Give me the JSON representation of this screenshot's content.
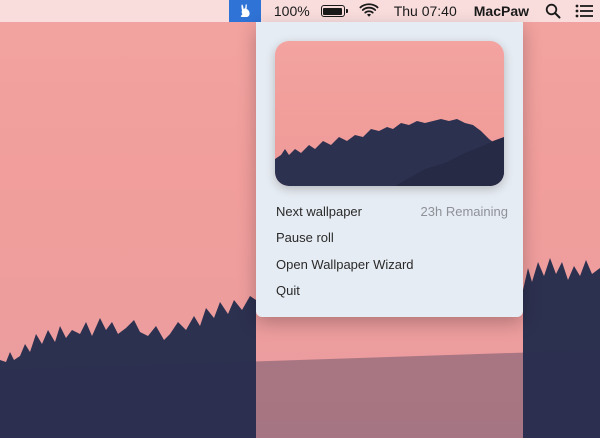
{
  "menubar": {
    "app_icon": "rabbit-icon",
    "battery_percent": "100%",
    "battery_level": 1.0,
    "wifi_icon": "wifi-icon",
    "clock": "Thu 07:40",
    "user": "MacPaw",
    "search_icon": "search-icon",
    "list_icon": "notification-list-icon",
    "accent_color": "#2f73d6"
  },
  "menu": {
    "preview_alt": "wallpaper-preview",
    "items": [
      {
        "label": "Next wallpaper",
        "detail": "23h Remaining"
      },
      {
        "label": "Pause roll"
      },
      {
        "label": "Open Wallpaper Wizard"
      },
      {
        "label": "Quit"
      }
    ]
  }
}
